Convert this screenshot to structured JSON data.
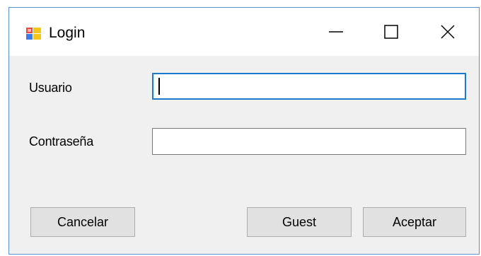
{
  "window": {
    "title": "Login",
    "icon": "winforms-app-icon",
    "controls": {
      "minimize_icon": "minimize-icon",
      "maximize_icon": "maximize-icon",
      "close_icon": "close-icon"
    }
  },
  "form": {
    "usuario": {
      "label": "Usuario",
      "value": ""
    },
    "contrasena": {
      "label": "Contraseña",
      "value": ""
    }
  },
  "buttons": {
    "cancel_label": "Cancelar",
    "guest_label": "Guest",
    "accept_label": "Aceptar"
  },
  "colors": {
    "focus_border": "#1979ca",
    "window_border": "#5a8fd0",
    "client_background": "#f0f0f0",
    "button_face": "#e1e1e1"
  }
}
